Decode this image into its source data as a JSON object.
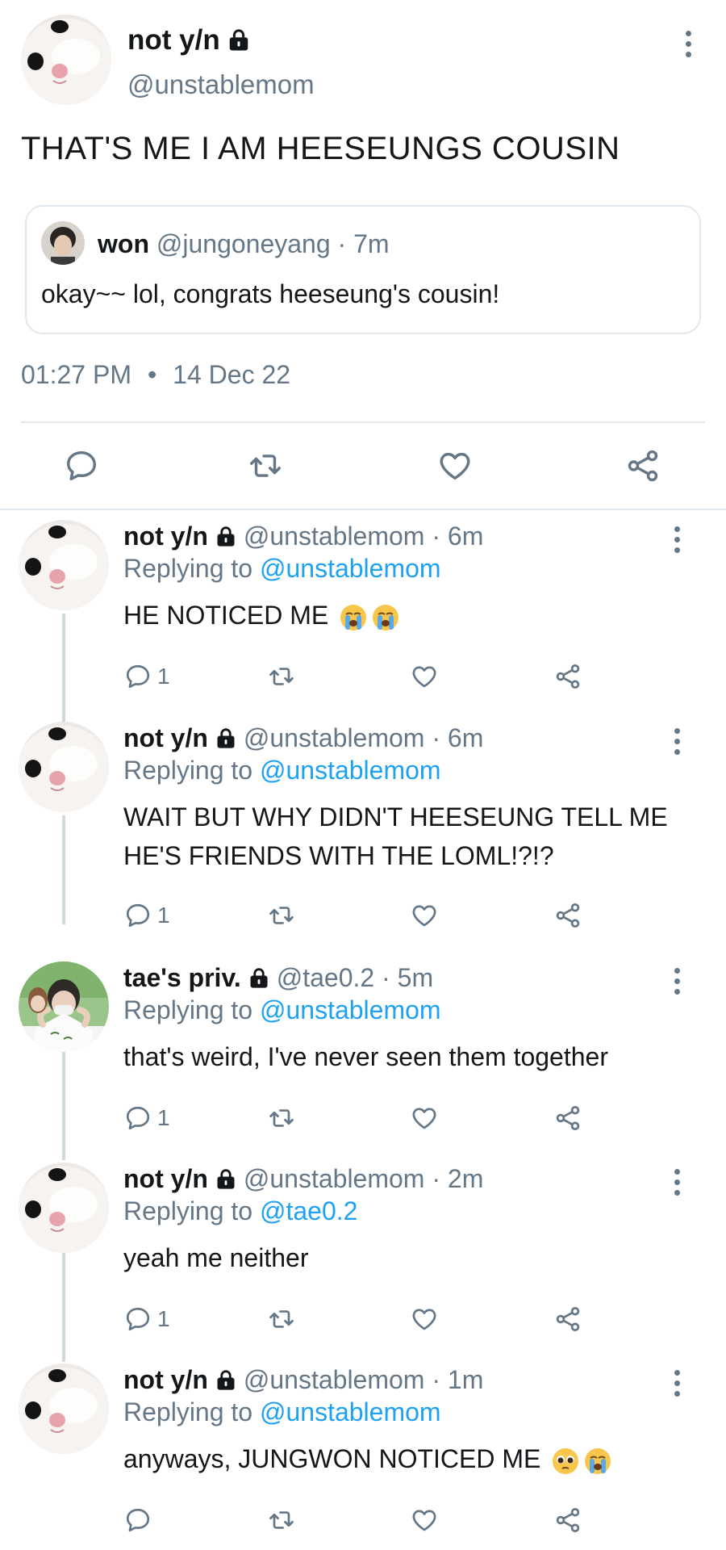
{
  "main_tweet": {
    "name": "not y/n",
    "handle": "@unstablemom",
    "text": "THAT'S ME I AM HEESEUNGS COUSIN",
    "quote": {
      "name": "won",
      "handle_time": "@jungoneyang · 7m",
      "text": "okay~~ lol, congrats heeseung's cousin!"
    },
    "time": "01:27 PM",
    "separator": "•",
    "date": "14 Dec 22"
  },
  "replies": [
    {
      "name": "not y/n",
      "meta": "@unstablemom · 6m",
      "replying_prefix": "Replying to",
      "replying_to": "@unstablemom",
      "text": "HE NOTICED ME",
      "reply_count": "1"
    },
    {
      "name": "not y/n",
      "meta": "@unstablemom · 6m",
      "replying_prefix": "Replying to",
      "replying_to": "@unstablemom",
      "text": "WAIT BUT WHY DIDN'T HEESEUNG TELL ME HE'S FRIENDS WITH THE LOML!?!?",
      "reply_count": "1"
    },
    {
      "name": "tae's priv.",
      "meta": "@tae0.2 · 5m",
      "replying_prefix": "Replying to",
      "replying_to": "@unstablemom",
      "text": "that's weird, I've never seen them together",
      "reply_count": "1"
    },
    {
      "name": "not y/n",
      "meta": "@unstablemom · 2m",
      "replying_prefix": "Replying to",
      "replying_to": "@tae0.2",
      "text": "yeah me neither",
      "reply_count": "1"
    },
    {
      "name": "not y/n",
      "meta": "@unstablemom · 1m",
      "replying_prefix": "Replying to",
      "replying_to": "@unstablemom",
      "text": "anyways, JUNGWON NOTICED ME",
      "reply_count": ""
    }
  ],
  "icons": {
    "reply": "comment-icon",
    "retweet": "retweet-icon",
    "like": "heart-icon",
    "share": "share-icon",
    "more": "more-vertical-icon",
    "lock": "lock-icon"
  },
  "colors": {
    "text": "#14171a",
    "muted": "#657786",
    "link": "#1da1f2",
    "border": "#e1e8ed"
  }
}
